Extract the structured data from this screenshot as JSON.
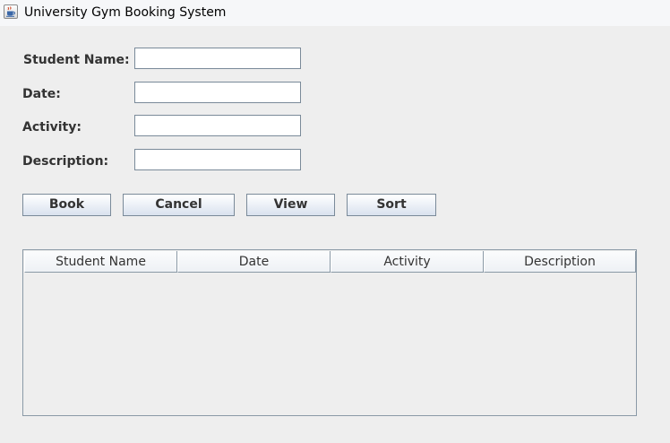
{
  "window": {
    "title": "University Gym Booking System",
    "icon": "java-cup-icon"
  },
  "form": {
    "student_name": {
      "label": "Student Name:",
      "value": ""
    },
    "date": {
      "label": "Date:",
      "value": ""
    },
    "activity": {
      "label": "Activity:",
      "value": ""
    },
    "description": {
      "label": "Description:",
      "value": ""
    }
  },
  "buttons": {
    "book": "Book",
    "cancel": "Cancel",
    "view": "View",
    "sort": "Sort"
  },
  "table": {
    "columns": [
      "Student Name",
      "Date",
      "Activity",
      "Description"
    ],
    "rows": []
  }
}
